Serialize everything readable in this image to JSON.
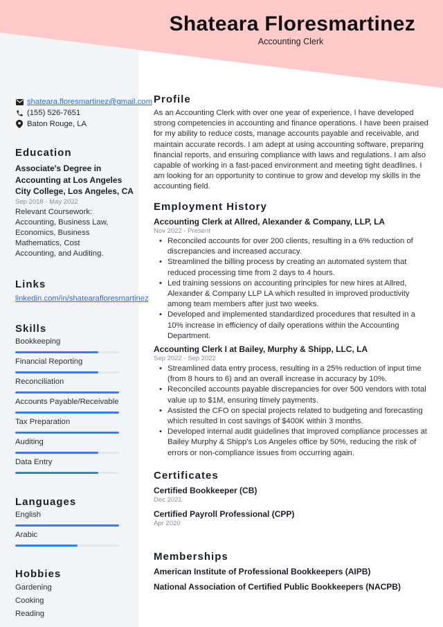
{
  "colors": {
    "header_pink": "#ffcaca",
    "sidebar_gray": "#f3f4f6",
    "accent_blue": "#3b7de8",
    "link_blue": "#2f6fd6"
  },
  "header": {
    "name": "Shateara Floresmartinez",
    "title": "Accounting Clerk"
  },
  "contact": {
    "email": {
      "icon": "envelope-icon",
      "value": "shateara.floresmartinez@gmail.com"
    },
    "phone": {
      "icon": "phone-icon",
      "value": "(155) 526-7651"
    },
    "location": {
      "icon": "map-pin-icon",
      "value": "Baton Rouge, LA"
    }
  },
  "education": {
    "heading": "Education",
    "degree": "Associate's Degree in Accounting at Los Angeles City College, Los Angeles, CA",
    "dates": "Sep 2018 - May 2022",
    "description": "Relevant Coursework: Accounting, Business Law, Economics, Business Mathematics, Cost Accounting, and Auditing."
  },
  "links": {
    "heading": "Links",
    "items": [
      "linkedin.com/in/shatearafloresmartinez"
    ]
  },
  "skills": {
    "heading": "Skills",
    "items": [
      {
        "label": "Bookkeeping",
        "level": 0.8
      },
      {
        "label": "Financial Reporting",
        "level": 0.8
      },
      {
        "label": "Reconciliation",
        "level": 1.0
      },
      {
        "label": "Accounts Payable/Receivable",
        "level": 1.0
      },
      {
        "label": "Tax Preparation",
        "level": 1.0
      },
      {
        "label": "Auditing",
        "level": 0.8
      },
      {
        "label": "Data Entry",
        "level": 0.8
      }
    ]
  },
  "languages": {
    "heading": "Languages",
    "items": [
      {
        "label": "English",
        "level": 1.0
      },
      {
        "label": "Arabic",
        "level": 0.6
      }
    ]
  },
  "hobbies": {
    "heading": "Hobbies",
    "items": [
      "Gardening",
      "Cooking",
      "Reading"
    ]
  },
  "profile": {
    "heading": "Profile",
    "text": "As an Accounting Clerk with over one year of experience, I have developed strong competencies in accounting and finance operations. I have been praised for my ability to reduce costs, manage accounts payable and receivable, and maintain accurate records. I am adept at using accounting software, preparing financial reports, and ensuring compliance with laws and regulations. I am also capable of working in a fast-paced environment and meeting tight deadlines. I am looking for an opportunity to continue to grow and develop my skills in the accounting field."
  },
  "employment": {
    "heading": "Employment History",
    "jobs": [
      {
        "title": "Accounting Clerk at Allred, Alexander & Company, LLP, LA",
        "dates": "Nov 2022 - Present",
        "bullets": [
          "Reconciled accounts for over 200 clients, resulting in a 6% reduction of discrepancies and increased accuracy.",
          "Streamlined the billing process by creating an automated system that reduced processing time from 2 days to 4 hours.",
          "Led training sessions on accounting principles for new hires at Allred, Alexander & Company LLP LA which resulted in improved productivity among team members after just two weeks.",
          "Developed and implemented standardized procedures that resulted in a 10% increase in efficiency of daily operations within the Accounting Department."
        ]
      },
      {
        "title": "Accounting Clerk I at Bailey, Murphy & Shipp, LLC, LA",
        "dates": "Sep 2022 - Sep 2022",
        "bullets": [
          "Streamlined data entry process, resulting in a 25% reduction of input time (from 8 hours to 6) and an overall increase in accuracy by 10%.",
          "Reconciled accounts payable discrepancies for over 500 vendors with total value up to $1M, ensuring timely payments.",
          "Assisted the CFO on special projects related to budgeting and forecasting which resulted in cost savings of $400K within 3 months.",
          "Developed internal audit guidelines that improved compliance processes at Bailey Murphy & Shipp's Los Angeles office by 50%, reducing the risk of errors or non-compliance issues from occurring again."
        ]
      }
    ]
  },
  "certificates": {
    "heading": "Certificates",
    "items": [
      {
        "name": "Certified Bookkeeper (CB)",
        "date": "Dec 2021"
      },
      {
        "name": "Certified Payroll Professional (CPP)",
        "date": "Apr 2020"
      }
    ]
  },
  "memberships": {
    "heading": "Memberships",
    "items": [
      "American Institute of Professional Bookkeepers (AIPB)",
      "National Association of Certified Public Bookkeepers (NACPB)"
    ]
  }
}
